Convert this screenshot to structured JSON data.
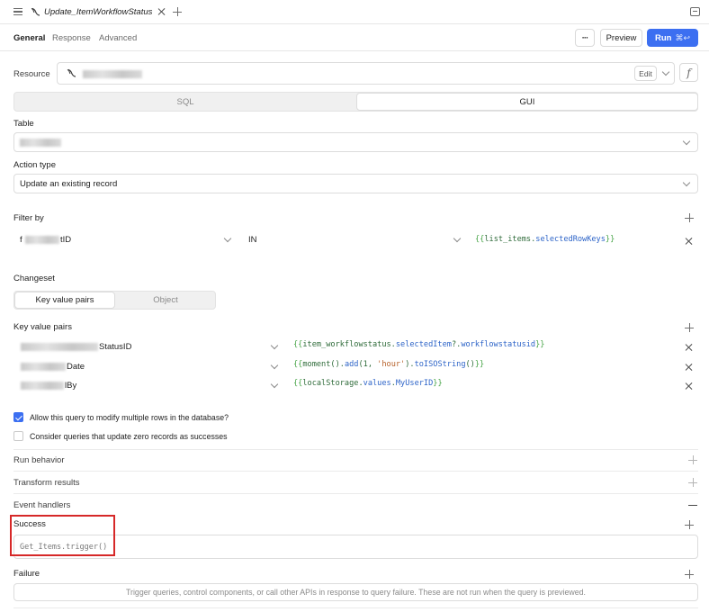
{
  "window": {
    "tab_title": "Update_ItemWorkflowStatus"
  },
  "subtabs": [
    {
      "label": "General",
      "active": true
    },
    {
      "label": "Response",
      "active": false
    },
    {
      "label": "Advanced",
      "active": false
    }
  ],
  "toolbar": {
    "more_label": "···",
    "preview_label": "Preview",
    "run_label": "Run",
    "run_shortcut": "⌘↩"
  },
  "resource": {
    "label": "Resource",
    "edit_label": "Edit",
    "fx_label": "f"
  },
  "mode_toggle": {
    "sql_label": "SQL",
    "gui_label": "GUI",
    "selected": "GUI"
  },
  "table": {
    "label": "Table"
  },
  "action_type": {
    "label": "Action type",
    "value": "Update an existing record"
  },
  "filter": {
    "label": "Filter by",
    "column_suffix": "tID",
    "column_prefix": "f",
    "operator": "IN",
    "value_parts": [
      "{{",
      "list_items",
      ".",
      "selectedRowKeys",
      "}}"
    ]
  },
  "changeset": {
    "label": "Changeset",
    "kv_label": "Key value pairs",
    "object_label": "Object",
    "selected": "Key value pairs"
  },
  "kv": {
    "label": "Key value pairs",
    "rows": [
      {
        "key_suffix": "StatusID",
        "value": "{{item_workflowstatus.selectedItem?.workflowstatusid}}"
      },
      {
        "key_suffix": "Date",
        "value": "{{moment().add(1, 'hour').toISOString()}}"
      },
      {
        "key_suffix": "lBy",
        "value": "{{localStorage.values.MyUserID}}"
      }
    ]
  },
  "options": {
    "allow_multiple": "Allow this query to modify multiple rows in the database?",
    "allow_multiple_checked": true,
    "zero_records": "Consider queries that update zero records as successes",
    "zero_records_checked": false
  },
  "sections": {
    "run_behavior": "Run behavior",
    "transform_results": "Transform results",
    "event_handlers": "Event handlers"
  },
  "success": {
    "label": "Success",
    "handler": "Get_Items.trigger()"
  },
  "failure": {
    "label": "Failure",
    "placeholder": "Trigger queries, control components, or call other APIs in response to query failure. These are not run when the query is previewed."
  },
  "colors": {
    "accent": "#3c6ff1",
    "highlight_box": "#d62828"
  }
}
